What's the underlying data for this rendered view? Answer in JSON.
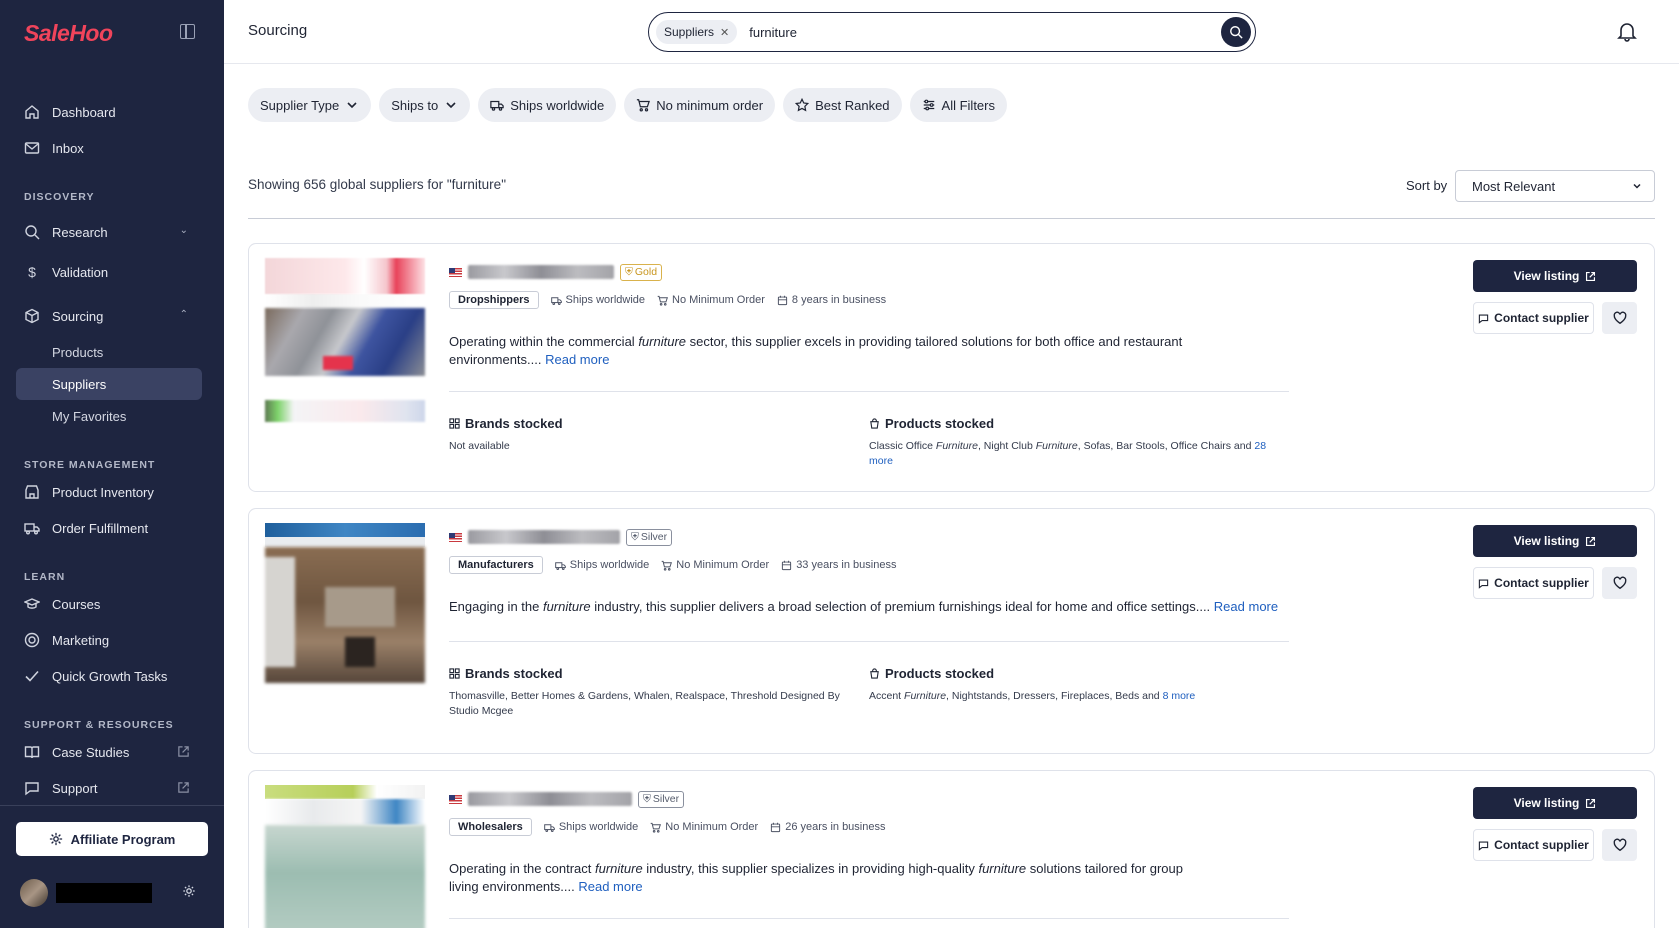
{
  "sidebar": {
    "logo": "SaleHoo",
    "nav": {
      "dashboard": "Dashboard",
      "inbox": "Inbox",
      "discovery_label": "DISCOVERY",
      "research": "Research",
      "validation": "Validation",
      "sourcing": "Sourcing",
      "products": "Products",
      "suppliers": "Suppliers",
      "my_favorites": "My Favorites",
      "store_label": "STORE MANAGEMENT",
      "product_inventory": "Product Inventory",
      "order_fulfillment": "Order Fulfillment",
      "learn_label": "LEARN",
      "courses": "Courses",
      "marketing": "Marketing",
      "quick_growth": "Quick Growth Tasks",
      "support_label": "SUPPORT & RESOURCES",
      "case_studies": "Case Studies",
      "support": "Support"
    },
    "affiliate": "Affiliate Program"
  },
  "header": {
    "title": "Sourcing",
    "search_chip": "Suppliers",
    "search_query": "furniture"
  },
  "filters": {
    "supplier_type": "Supplier Type",
    "ships_to": "Ships to",
    "ships_worldwide": "Ships worldwide",
    "no_min": "No minimum order",
    "best_ranked": "Best Ranked",
    "all_filters": "All Filters"
  },
  "results": {
    "count_text": "Showing 656 global suppliers for \"furniture\"",
    "sort_label": "Sort by",
    "sort_value": "Most Relevant"
  },
  "labels": {
    "view_listing": "View listing",
    "contact_supplier": "Contact supplier",
    "read_more": "Read more",
    "brands_stocked": "Brands stocked",
    "products_stocked": "Products stocked",
    "ships_worldwide": "Ships worldwide",
    "no_min_order": "No Minimum Order"
  },
  "suppliers": [
    {
      "tier": "Gold",
      "type": "Dropshippers",
      "years": "8 years in business",
      "desc_before": "Operating within the commercial ",
      "desc_em": "furniture",
      "desc_after": " sector, this supplier excels in providing tailored solutions for both office and restaurant environments.... ",
      "brands": "Not available",
      "products_p1": "Classic Office ",
      "products_em1": "Furniture",
      "products_p2": ", Night Club ",
      "products_em2": "Furniture",
      "products_p3": ", Sofas, Bar Stools, Office Chairs and ",
      "products_more": "28 more"
    },
    {
      "tier": "Silver",
      "type": "Manufacturers",
      "years": "33 years in business",
      "desc_before": "Engaging in the ",
      "desc_em": "furniture",
      "desc_after": " industry, this supplier delivers a broad selection of premium furnishings ideal for home and office settings.... ",
      "brands": "Thomasville, Better Homes & Gardens, Whalen, Realspace, Threshold Designed By Studio Mcgee",
      "products_p1": "Accent ",
      "products_em1": "Furniture",
      "products_p2": ", Nightstands, Dressers, Fireplaces, Beds and ",
      "products_more": "8 more"
    },
    {
      "tier": "Silver",
      "type": "Wholesalers",
      "years": "26 years in business",
      "desc_before": "Operating in the contract ",
      "desc_em": "furniture",
      "desc_mid": " industry, this supplier specializes in providing high-quality ",
      "desc_em2": "furniture",
      "desc_after": " solutions tailored for group living environments.... "
    }
  ]
}
